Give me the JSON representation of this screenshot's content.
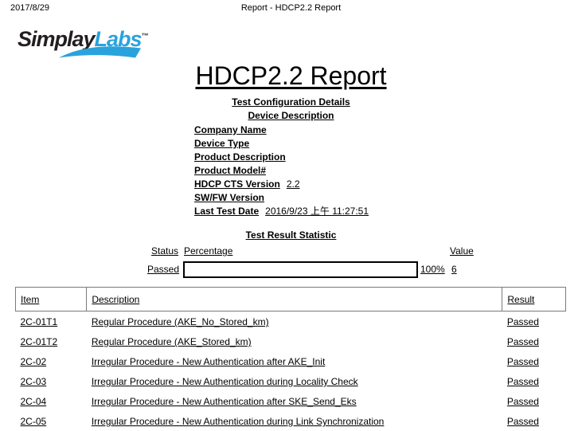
{
  "print_header": {
    "date": "2017/8/29",
    "title": "Report - HDCP2.2 Report"
  },
  "logo": {
    "part1": "Simplay",
    "part2": "Labs",
    "trademark": "™",
    "color_dark": "#231f20",
    "color_blue": "#2aa3dc"
  },
  "report": {
    "title": "HDCP2.2 Report",
    "config_heading": "Test Configuration Details",
    "device_heading": "Device Description"
  },
  "device_description": [
    {
      "label": "Company Name",
      "value": ""
    },
    {
      "label": "Device Type",
      "value": ""
    },
    {
      "label": "Product Description",
      "value": ""
    },
    {
      "label": "Product Model#",
      "value": ""
    },
    {
      "label": "HDCP CTS Version",
      "value": "2.2"
    },
    {
      "label": "SW/FW Version",
      "value": ""
    },
    {
      "label": "Last Test Date",
      "value": "2016/9/23 上午 11:27:51"
    }
  ],
  "statistic": {
    "heading": "Test Result Statistic",
    "headers": {
      "status": "Status",
      "percentage": "Percentage",
      "value": "Value"
    },
    "row": {
      "status": "Passed",
      "percent_label": "100%",
      "percent_number": 100,
      "value": "6"
    }
  },
  "results": {
    "columns": [
      "Item",
      "Description",
      "Result"
    ],
    "rows": [
      {
        "item": "2C-01T1",
        "description": "Regular Procedure (AKE_No_Stored_km)",
        "result": "Passed"
      },
      {
        "item": "2C-01T2",
        "description": "Regular Procedure (AKE_Stored_km)",
        "result": "Passed"
      },
      {
        "item": "2C-02",
        "description": "Irregular Procedure - New Authentication after AKE_Init",
        "result": "Passed"
      },
      {
        "item": "2C-03",
        "description": "Irregular Procedure - New Authentication during Locality Check",
        "result": "Passed"
      },
      {
        "item": "2C-04",
        "description": "Irregular Procedure - New Authentication after SKE_Send_Eks",
        "result": "Passed"
      },
      {
        "item": "2C-05",
        "description": "Irregular Procedure - New Authentication during Link Synchronization",
        "result": "Passed"
      }
    ]
  }
}
